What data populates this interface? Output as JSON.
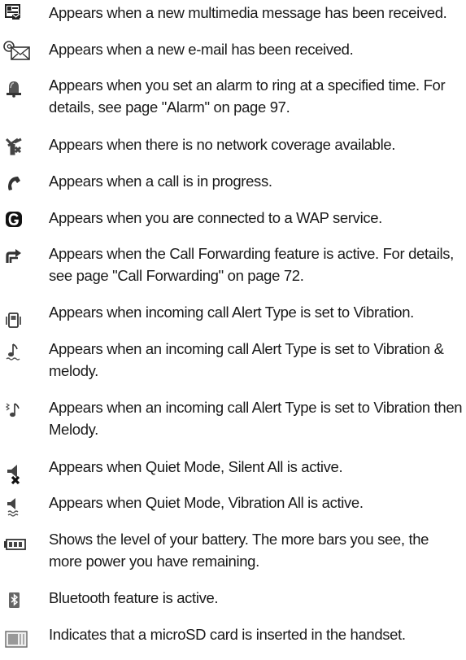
{
  "entries": [
    {
      "icon": "multimedia-message-icon",
      "text": "Appears when a new multimedia message has been received."
    },
    {
      "icon": "email-icon",
      "text": "Appears when a new e-mail has been received."
    },
    {
      "icon": "alarm-bell-icon",
      "text": "Appears when you set an alarm to ring at a specified time. For details, see page \"Alarm\" on page 97."
    },
    {
      "icon": "no-network-icon",
      "text": "Appears when there is no network coverage available."
    },
    {
      "icon": "call-in-progress-icon",
      "text": "Appears when a call is in progress."
    },
    {
      "icon": "wap-g-icon",
      "text": "Appears when you are connected to a WAP service."
    },
    {
      "icon": "call-forwarding-icon",
      "text": "Appears when the Call Forwarding feature is active. For details, see page \"Call Forwarding\" on page 72."
    },
    {
      "icon": "vibration-icon",
      "text": "Appears when incoming call Alert Type is set to Vibration."
    },
    {
      "icon": "vibration-and-melody-icon",
      "text": "Appears when an incoming call Alert Type is set to Vibration & melody."
    },
    {
      "icon": "vibration-then-melody-icon",
      "text": "Appears when an incoming call Alert Type is set to Vibration then Melody."
    },
    {
      "icon": "silent-all-icon",
      "text": "Appears when Quiet Mode, Silent All is active."
    },
    {
      "icon": "vibration-all-icon",
      "text": "Appears when Quiet Mode, Vibration All is active."
    },
    {
      "icon": "battery-icon",
      "text": "Shows the level of your battery. The more bars you see, the more power you have remaining."
    },
    {
      "icon": "bluetooth-icon",
      "text": "Bluetooth feature is active."
    },
    {
      "icon": "microsd-card-icon",
      "text": "Indicates that a microSD card is inserted in the handset."
    }
  ]
}
